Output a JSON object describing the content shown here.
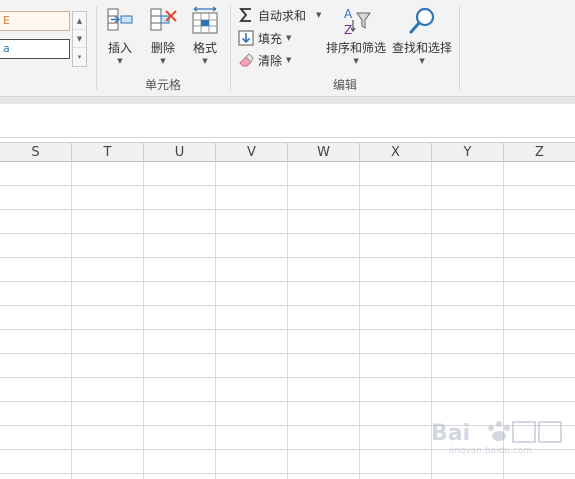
{
  "ribbon": {
    "style_boxes": [
      "E",
      "a"
    ],
    "cells_group": {
      "label": "单元格",
      "insert_label": "插入",
      "delete_label": "删除",
      "format_label": "格式"
    },
    "editing_group": {
      "label": "编辑",
      "autosum_label": "自动求和",
      "fill_label": "填充",
      "clear_label": "清除",
      "sort_filter_label": "排序和筛选",
      "find_select_label": "查找和选择"
    }
  },
  "grid": {
    "columns": [
      "S",
      "T",
      "U",
      "V",
      "W",
      "X",
      "Y",
      "Z"
    ]
  },
  "colors": {
    "ribbon_bg": "#f3f3f3",
    "accent_blue": "#2e75b6",
    "delete_red": "#e0492b",
    "grid_line": "#dadada"
  },
  "icons": {
    "insert": "insert-cells-icon",
    "delete": "delete-cells-icon",
    "format": "format-cells-icon",
    "autosum": "sigma-icon",
    "fill": "fill-down-icon",
    "clear": "eraser-icon",
    "sort_filter": "sort-filter-icon",
    "find_select": "magnifier-icon"
  }
}
